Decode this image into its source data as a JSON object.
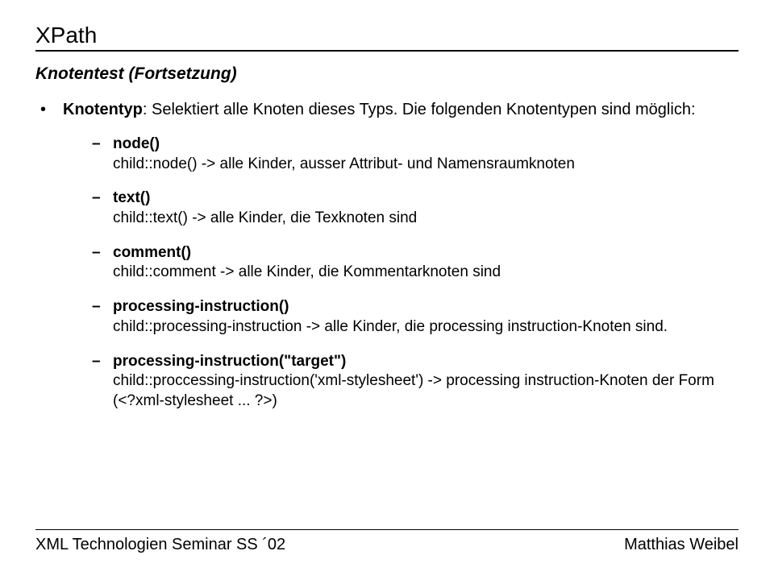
{
  "title": "XPath",
  "subtitle": "Knotentest (Fortsetzung)",
  "bullet": {
    "lead": "Knotentyp",
    "text": ": Selektiert alle Knoten dieses Typs. Die folgenden Knotentypen sind möglich:"
  },
  "items": [
    {
      "head": "node()",
      "desc": "child::node() -> alle Kinder, ausser Attribut- und Namensraumknoten"
    },
    {
      "head": "text()",
      "desc": "child::text() -> alle Kinder, die Texknoten sind"
    },
    {
      "head": "comment()",
      "desc": "child::comment -> alle Kinder, die Kommentarknoten sind"
    },
    {
      "head": "processing-instruction()",
      "desc": "child::processing-instruction -> alle Kinder, die processing instruction-Knoten sind."
    },
    {
      "head": "processing-instruction(\"target\")",
      "desc": "child::proccessing-instruction('xml-stylesheet') -> processing instruction-Knoten der Form (<?xml-stylesheet ... ?>)"
    }
  ],
  "footer": {
    "left": "XML Technologien Seminar SS ´02",
    "right": "Matthias Weibel"
  }
}
